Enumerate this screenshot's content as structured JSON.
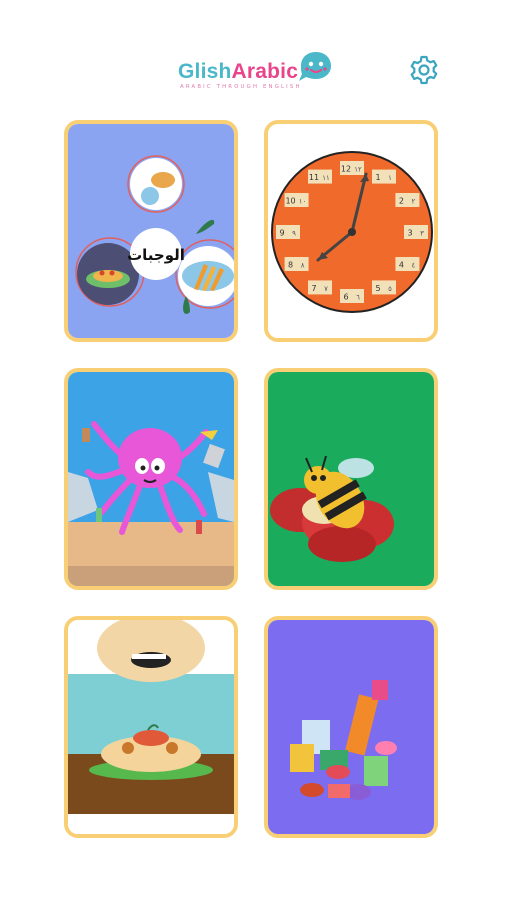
{
  "app": {
    "brand_prefix": "Glish",
    "brand_suffix": "Arabic",
    "tagline": "ARABIC THROUGH ENGLISH"
  },
  "header": {
    "settings_icon": "gear-icon"
  },
  "colors": {
    "card_border": "#f8cf75",
    "brand_teal": "#4ab8c9",
    "brand_pink": "#e8458a"
  },
  "cards": [
    {
      "id": "meals",
      "label": "الوجبات",
      "bg": "#8aa4f2"
    },
    {
      "id": "clock",
      "bg": "#ffffff",
      "numbers": [
        "12",
        "1",
        "2",
        "3",
        "4",
        "5",
        "6",
        "7",
        "8",
        "9",
        "10",
        "11"
      ],
      "arabic": [
        "١٢",
        "١",
        "٢",
        "٣",
        "٤",
        "٥",
        "٦",
        "٧",
        "٨",
        "٩",
        "١٠",
        "١١"
      ]
    },
    {
      "id": "octopus",
      "bg": "#3ba3e6"
    },
    {
      "id": "bee",
      "bg": "#1aac5c"
    },
    {
      "id": "spaghetti",
      "bg": "#ffffff"
    },
    {
      "id": "candy",
      "bg": "#7b6cf0"
    }
  ]
}
